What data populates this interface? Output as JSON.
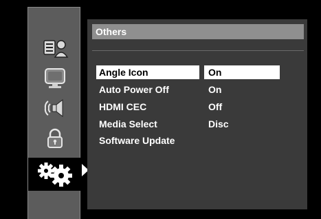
{
  "sidebar": {
    "items": [
      {
        "name": "language",
        "icon": "language-person-icon",
        "selected": false
      },
      {
        "name": "display",
        "icon": "tv-monitor-icon",
        "selected": false
      },
      {
        "name": "audio",
        "icon": "speaker-sound-icon",
        "selected": false
      },
      {
        "name": "parental",
        "icon": "padlock-icon",
        "selected": false
      },
      {
        "name": "others",
        "icon": "gears-icon",
        "selected": true
      }
    ]
  },
  "panel": {
    "title": "Others",
    "rows": [
      {
        "label": "Angle Icon",
        "value": "On",
        "selected": true
      },
      {
        "label": "Auto Power Off",
        "value": "On",
        "selected": false
      },
      {
        "label": "HDMI CEC",
        "value": "Off",
        "selected": false
      },
      {
        "label": "Media Select",
        "value": "Disc",
        "selected": false
      },
      {
        "label": "Software Update",
        "value": "",
        "selected": false
      }
    ]
  },
  "colors": {
    "background": "#000000",
    "sidebar": "#5c5c5c",
    "panel": "#3a3a3a",
    "title_bar": "#8f8f8f",
    "highlight": "#ffffff"
  }
}
